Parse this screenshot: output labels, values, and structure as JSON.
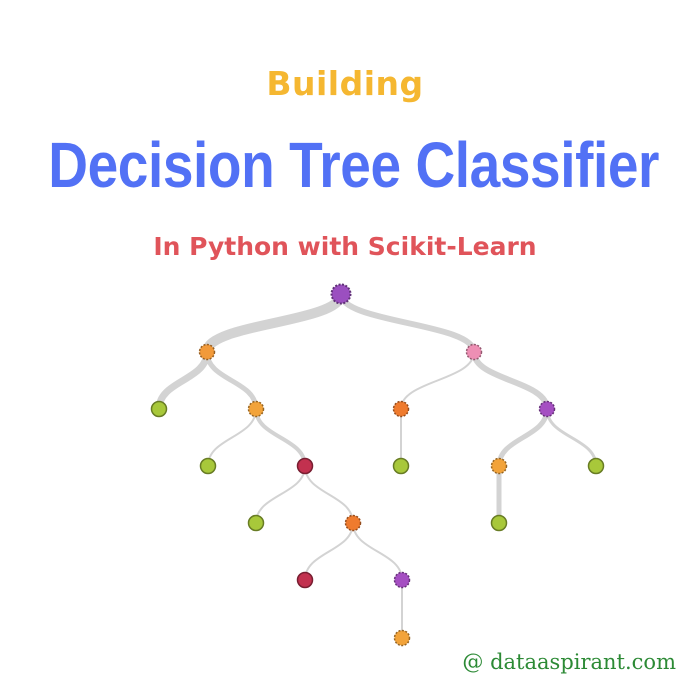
{
  "poster": {
    "title_top": "Building",
    "title_main": "Decision Tree Classifier",
    "subtitle": "In Python with Scikit-Learn",
    "watermark": "@ dataaspirant.com"
  },
  "colors": {
    "title_top": "#f5b731",
    "title_main": "#5271f5",
    "subtitle": "#e0545a",
    "watermark": "#2c8a35",
    "edge": "#d3d3d3"
  },
  "tree_nodes": [
    {
      "id": "root",
      "color": "#9b4fc0"
    },
    {
      "id": "l",
      "color": "#f29a3a"
    },
    {
      "id": "r",
      "color": "#ee8fb4"
    },
    {
      "id": "ll",
      "color": "#a8c83a"
    },
    {
      "id": "lr",
      "color": "#f2a33a"
    },
    {
      "id": "rl",
      "color": "#ef7b2e"
    },
    {
      "id": "rr",
      "color": "#a54fc2"
    },
    {
      "id": "lrl",
      "color": "#a8c83a"
    },
    {
      "id": "lrr",
      "color": "#c2314f"
    },
    {
      "id": "rll",
      "color": "#a8c83a"
    },
    {
      "id": "rrl",
      "color": "#f2a33a"
    },
    {
      "id": "rrr",
      "color": "#a8c83a"
    },
    {
      "id": "lrrl",
      "color": "#a8c83a"
    },
    {
      "id": "lrrr",
      "color": "#ef7b2e"
    },
    {
      "id": "rrll",
      "color": "#a8c83a"
    },
    {
      "id": "lrrrl",
      "color": "#c2314f"
    },
    {
      "id": "lrrrr",
      "color": "#a54fc2"
    },
    {
      "id": "lrrrrl",
      "color": "#f2a33a"
    }
  ]
}
